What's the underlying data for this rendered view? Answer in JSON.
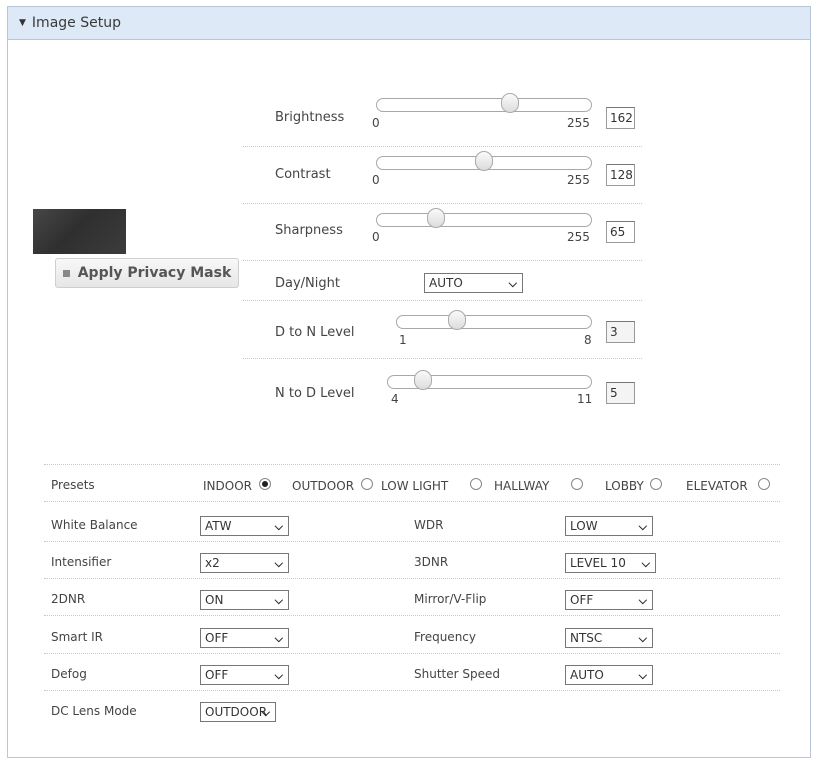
{
  "header": {
    "title": "Image Setup"
  },
  "privacy_mask": {
    "label": "Apply Privacy Mask"
  },
  "sliders": [
    {
      "label": "Brightness",
      "min": "0",
      "max": "255",
      "value": "162",
      "fraction": 0.635
    },
    {
      "label": "Contrast",
      "min": "0",
      "max": "255",
      "value": "128",
      "fraction": 0.5
    },
    {
      "label": "Sharpness",
      "min": "0",
      "max": "255",
      "value": "65",
      "fraction": 0.255
    },
    {
      "label": "D to N Level",
      "min": "1",
      "max": "8",
      "value": "3",
      "fraction": 0.29
    },
    {
      "label": "N to D Level",
      "min": "4",
      "max": "11",
      "value": "5",
      "fraction": 0.14
    }
  ],
  "day_night": {
    "label": "Day/Night",
    "value": "AUTO"
  },
  "presets": {
    "label": "Presets",
    "options": [
      "INDOOR",
      "OUTDOOR",
      "LOW LIGHT",
      "HALLWAY",
      "LOBBY",
      "ELEVATOR"
    ],
    "selected": "INDOOR"
  },
  "settings_left": [
    {
      "label": "White Balance",
      "value": "ATW"
    },
    {
      "label": "Intensifier",
      "value": "x2"
    },
    {
      "label": "2DNR",
      "value": "ON"
    },
    {
      "label": "Smart IR",
      "value": "OFF"
    },
    {
      "label": "Defog",
      "value": "OFF"
    },
    {
      "label": "DC Lens Mode",
      "value": "OUTDOOR"
    }
  ],
  "settings_right": [
    {
      "label": "WDR",
      "value": "LOW"
    },
    {
      "label": "3DNR",
      "value": "LEVEL 10"
    },
    {
      "label": "Mirror/V-Flip",
      "value": "OFF"
    },
    {
      "label": "Frequency",
      "value": "NTSC"
    },
    {
      "label": "Shutter Speed",
      "value": "AUTO"
    }
  ]
}
